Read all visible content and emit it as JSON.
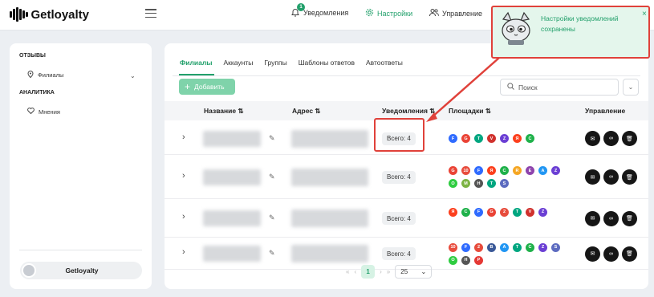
{
  "app": {
    "name": "Getloyalty"
  },
  "topnav": {
    "notifications": "Уведомления",
    "notif_count": "1",
    "settings": "Настройки",
    "manage": "Управление"
  },
  "toast": {
    "text": "Настройки уведомлений сохранены",
    "close": "×"
  },
  "sidebar": {
    "sections": [
      {
        "title": "ОТЗЫВЫ",
        "items": [
          {
            "label": "Филиалы",
            "icon": "map-pin-icon",
            "expandable": true
          }
        ]
      },
      {
        "title": "АНАЛИТИКА",
        "items": [
          {
            "label": "Мнения",
            "icon": "heart-icon",
            "expandable": false
          }
        ]
      }
    ],
    "user": "Getloyalty"
  },
  "tabs": [
    "Филиалы",
    "Аккаунты",
    "Группы",
    "Шаблоны ответов",
    "Автоответы"
  ],
  "active_tab": "Филиалы",
  "toolbar": {
    "add_label": "Добавить",
    "search_placeholder": "Поиск"
  },
  "table": {
    "columns": [
      "Название ⇅",
      "Адрес ⇅",
      "Уведомления ⇅",
      "Площадки ⇅",
      "Управление"
    ],
    "rows": [
      {
        "notifications": "Всего: 4",
        "platforms": [
          "F",
          "G",
          "T",
          "V",
          "Z",
          "Я",
          "C"
        ]
      },
      {
        "notifications": "Всего: 4",
        "platforms": [
          "G",
          "101",
          "F",
          "Я",
          "C",
          "R",
          "E",
          "A",
          "Z",
          "O",
          "M",
          "H",
          "T",
          "S"
        ]
      },
      {
        "notifications": "Всего: 4",
        "platforms": [
          "Я",
          "C",
          "F",
          "G",
          "2",
          "T",
          "V",
          "Z"
        ]
      },
      {
        "notifications": "Всего: 4",
        "platforms": [
          "101",
          "F",
          "2",
          "B",
          "A",
          "T",
          "C",
          "Z",
          "S",
          "O",
          "H",
          "P"
        ]
      }
    ]
  },
  "pagination": {
    "current": "1",
    "per_page": "25",
    "first": "«",
    "prev": "‹",
    "next": "›",
    "last": "»"
  },
  "colors": {
    "accent": "#22a06b",
    "highlight": "#e0413a",
    "button": "#161616"
  }
}
